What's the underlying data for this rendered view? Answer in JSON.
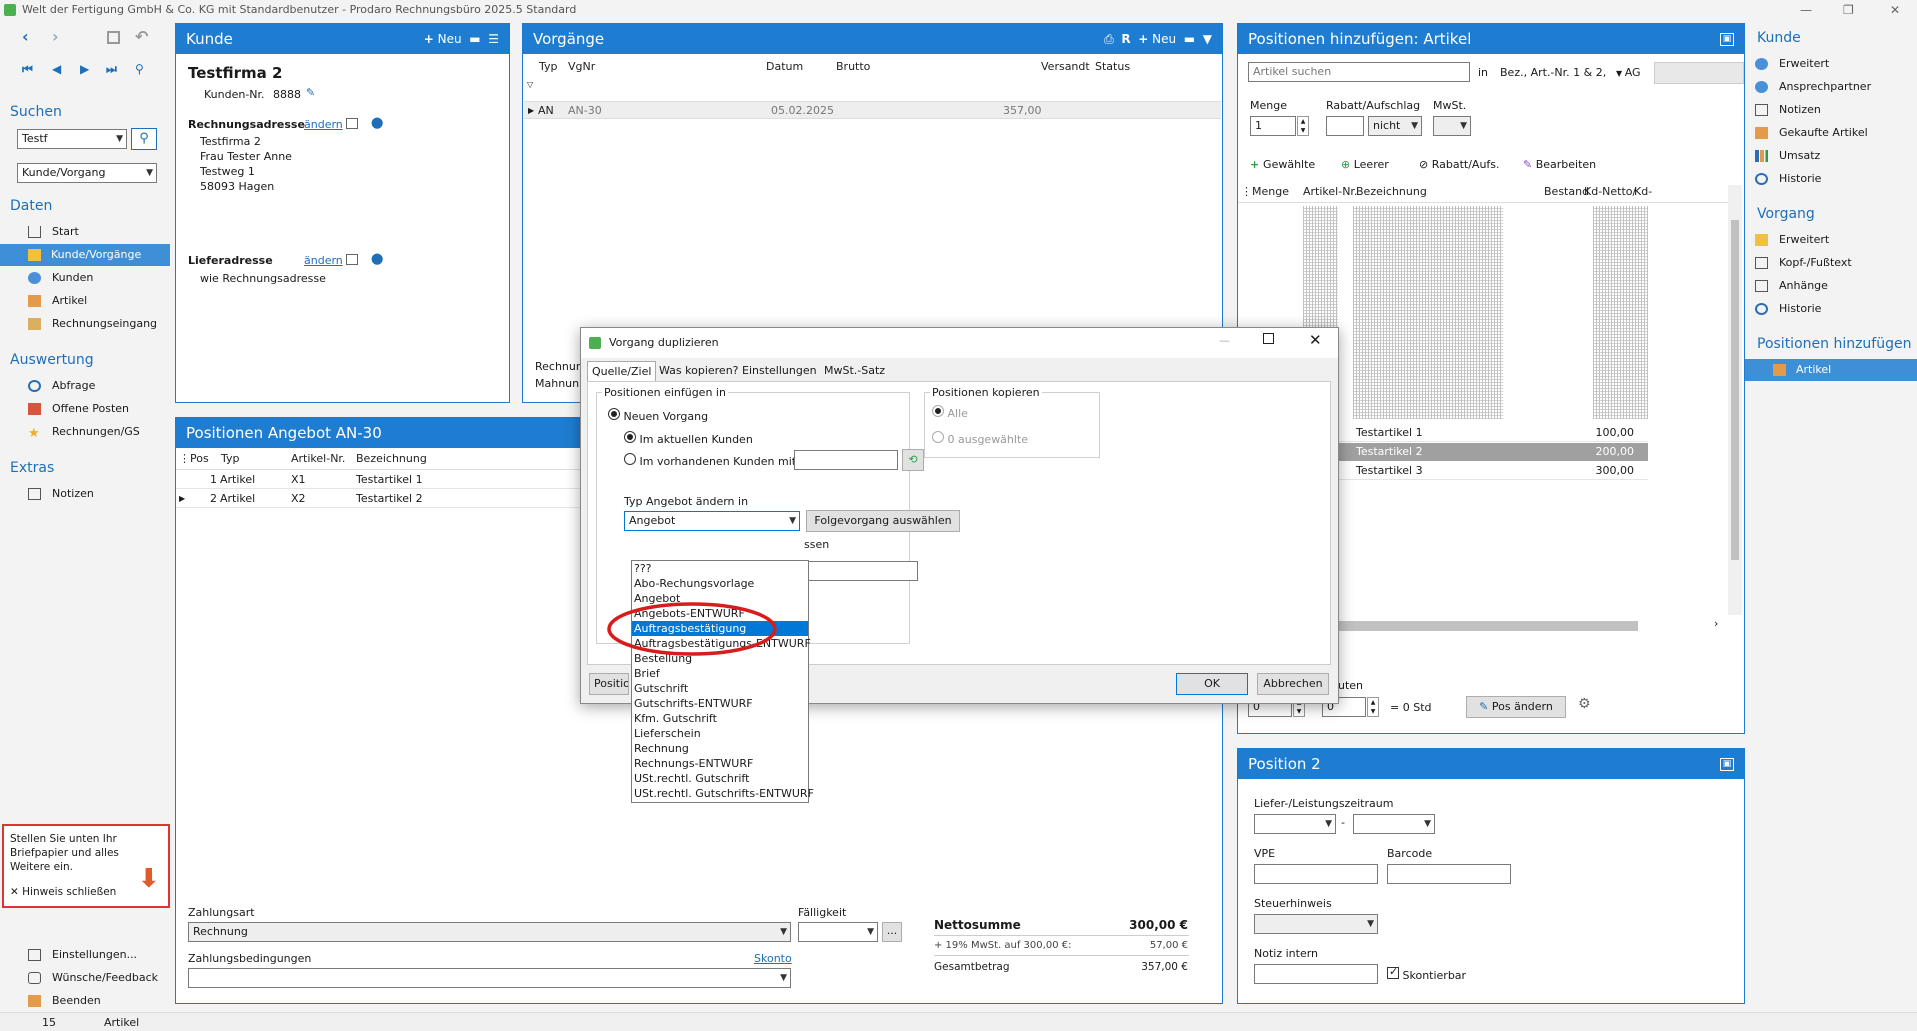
{
  "window": {
    "title": "Welt der Fertigung GmbH & Co. KG mit Standardbenutzer  -  Prodaro Rechnungsbüro 2025.5 Standard"
  },
  "nav": {
    "search_heading": "Suchen",
    "search_value": "Testf",
    "search_scope": "Kunde/Vorgang",
    "daten_heading": "Daten",
    "daten": [
      "Start",
      "Kunde/Vorgänge",
      "Kunden",
      "Artikel",
      "Rechnungseingang"
    ],
    "auswertung_heading": "Auswertung",
    "auswertung": [
      "Abfrage",
      "Offene Posten",
      "Rechnungen/GS"
    ],
    "extras_heading": "Extras",
    "extras": [
      "Notizen"
    ],
    "hint": "Stellen Sie unten Ihr Briefpapier und alles Weitere ein.",
    "hint_close": "Hinweis schließen",
    "bottom": [
      "Einstellungen...",
      "Wünsche/Feedback",
      "Beenden"
    ]
  },
  "kunde": {
    "header": "Kunde",
    "new_label": "Neu",
    "name": "Testfirma 2",
    "kdnr_label": "Kunden-Nr.",
    "kdnr": "8888",
    "billing_label": "Rechnungsadresse",
    "change_label": "ändern",
    "billing_lines": [
      "Testfirma 2",
      "Frau Tester Anne",
      "Testweg 1",
      "58093 Hagen"
    ],
    "delivery_label": "Lieferadresse",
    "delivery_value": "wie Rechnungsadresse"
  },
  "vorgaenge": {
    "header": "Vorgänge",
    "new_label": "Neu",
    "columns": [
      "Typ",
      "VgNr",
      "Datum",
      "Brutto",
      "Versandt",
      "Status"
    ],
    "rows": [
      {
        "typ": "AN",
        "vgnr": "AN-30",
        "datum": "05.02.2025",
        "brutto": "357,00"
      }
    ],
    "footer_lines": [
      "Rechnun",
      "Mahnun"
    ]
  },
  "positionen": {
    "header": "Positionen Angebot AN-30",
    "columns": [
      "Pos",
      "Typ",
      "Artikel-Nr.",
      "Bezeichnung"
    ],
    "rows": [
      {
        "pos": "1",
        "typ": "Artikel",
        "nr": "X1",
        "bez": "Testartikel 1"
      },
      {
        "pos": "2",
        "typ": "Artikel",
        "nr": "X2",
        "bez": "Testartikel 2"
      }
    ],
    "zahlungsart_label": "Zahlungsart",
    "zahlungsart": "Rechnung",
    "faelligkeit_label": "Fälligkeit",
    "zahlungsbed_label": "Zahlungsbedingungen",
    "skonto_label": "Skonto",
    "netto_label": "Nettosumme",
    "netto": "300,00 €",
    "mwst_label": "+ 19% MwSt. auf 300,00 €:",
    "mwst": "57,00 €",
    "gesamt_label": "Gesamtbetrag",
    "gesamt": "357,00 €"
  },
  "artikel_panel": {
    "header": "Positionen hinzufügen: Artikel",
    "search_placeholder": "Artikel suchen",
    "in_label": "in",
    "search_field": "Bez., Art.-Nr. 1 & 2,",
    "ag_label": "AG",
    "menge_label": "Menge",
    "menge": "1",
    "rabatt_label": "Rabatt/Aufschlag",
    "rabatt_mode": "nicht",
    "mwst_label": "MwSt.",
    "toolbar": [
      "Gewählte",
      "Leerer",
      "Rabatt/Aufs.",
      "Bearbeiten"
    ],
    "columns": [
      "Menge",
      "Artikel-Nr.",
      "Bezeichnung",
      "Bestand",
      "Kd-Netto/",
      "Kd-"
    ],
    "visible_rows": [
      {
        "bez": "Testartikel 1",
        "netto": "100,00"
      },
      {
        "bez": "Testartikel 2",
        "netto": "200,00"
      },
      {
        "bez": "Testartikel 3",
        "netto": "300,00"
      }
    ],
    "bottom_label": "uten",
    "std_label": "= 0 Std",
    "pos_btn": "Pos ändern",
    "spin1": "0",
    "spin2": "0"
  },
  "position2": {
    "header": "Position 2",
    "zeitraum_label": "Liefer-/Leistungszeitraum",
    "dash": "-",
    "vpe_label": "VPE",
    "barcode_label": "Barcode",
    "steuer_label": "Steuerhinweis",
    "notiz_label": "Notiz intern",
    "skonto_label": "Skontierbar"
  },
  "rightnav": {
    "kunde_heading": "Kunde",
    "kunde": [
      "Erweitert",
      "Ansprechpartner",
      "Notizen",
      "Gekaufte Artikel",
      "Umsatz",
      "Historie"
    ],
    "vorgang_heading": "Vorgang",
    "vorgang": [
      "Erweitert",
      "Kopf-/Fußtext",
      "Anhänge",
      "Historie"
    ],
    "pos_heading": "Positionen hinzufügen",
    "pos": [
      "Artikel"
    ]
  },
  "dialog": {
    "title": "Vorgang duplizieren",
    "tabs": [
      "Quelle/Ziel",
      "Was kopieren?",
      "Einstellungen",
      "MwSt.-Satz"
    ],
    "group_insert": "Positionen einfügen in",
    "neuer_vorgang": "Neuen Vorgang",
    "im_aktuellen": "Im aktuellen Kunden",
    "im_vorhandenen": "Im vorhandenen Kunden mit KdNr",
    "typ_label": "Typ Angebot ändern in",
    "typ_value": "Angebot",
    "folge_btn": "Folgevorgang auswählen",
    "hidden_text": "ssen",
    "group_copy": "Positionen kopieren",
    "alle": "Alle",
    "ausgewaehlte": "0 ausgewählte",
    "left_btn": "Positio",
    "ok": "OK",
    "cancel": "Abbrechen",
    "options": [
      "???",
      "Abo-Rechungsvorlage",
      "Angebot",
      "Angebots-ENTWURF",
      "Auftragsbestätigung",
      "Auftragsbestätigungs-ENTWURF",
      "Bestellung",
      "Brief",
      "Gutschrift",
      "Gutschrifts-ENTWURF",
      "Kfm. Gutschrift",
      "Lieferschein",
      "Rechnung",
      "Rechnungs-ENTWURF",
      "USt.rechtl. Gutschrift",
      "USt.rechtl. Gutschrifts-ENTWURF"
    ],
    "selected_index": 4
  },
  "status": {
    "left": "15",
    "right": "Artikel"
  },
  "colors": {
    "accent": "#1f7dd1",
    "selection": "#0078d7",
    "highlight": "#d81b1b"
  }
}
